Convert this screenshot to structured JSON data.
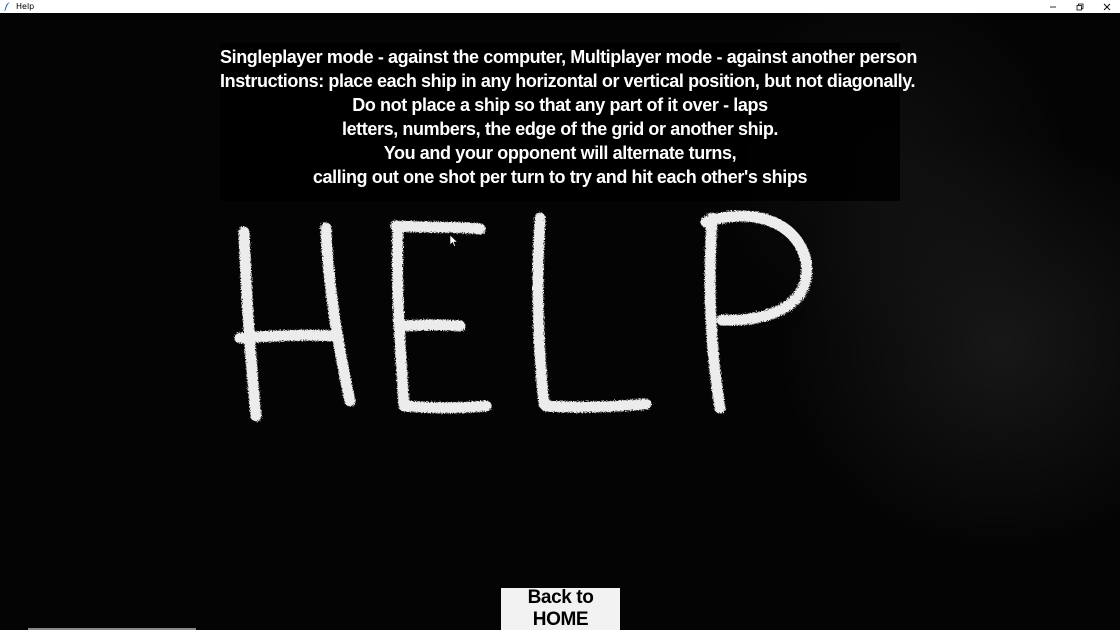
{
  "window": {
    "title": "Help",
    "controls": [
      "minimize-icon",
      "restore-icon",
      "close-icon"
    ]
  },
  "instructions": {
    "lines": [
      "Singleplayer mode - against the computer, Multiplayer mode - against another person",
      "Instructions: place each ship in any horizontal or vertical position, but not diagonally.",
      "Do not place a ship so that any part of it over - laps",
      "letters, numbers, the edge of the grid or another ship.",
      "You and your opponent will alternate turns,",
      "calling out one shot per turn to try and hit each other's ships"
    ]
  },
  "background_art": {
    "text": "HELP",
    "style": "chalk-on-blackboard"
  },
  "buttons": {
    "back_label": "Back to HOME"
  },
  "colors": {
    "background": "#050505",
    "text": "#ffffff",
    "button_bg": "#f2f2f2",
    "button_text": "#000000"
  }
}
